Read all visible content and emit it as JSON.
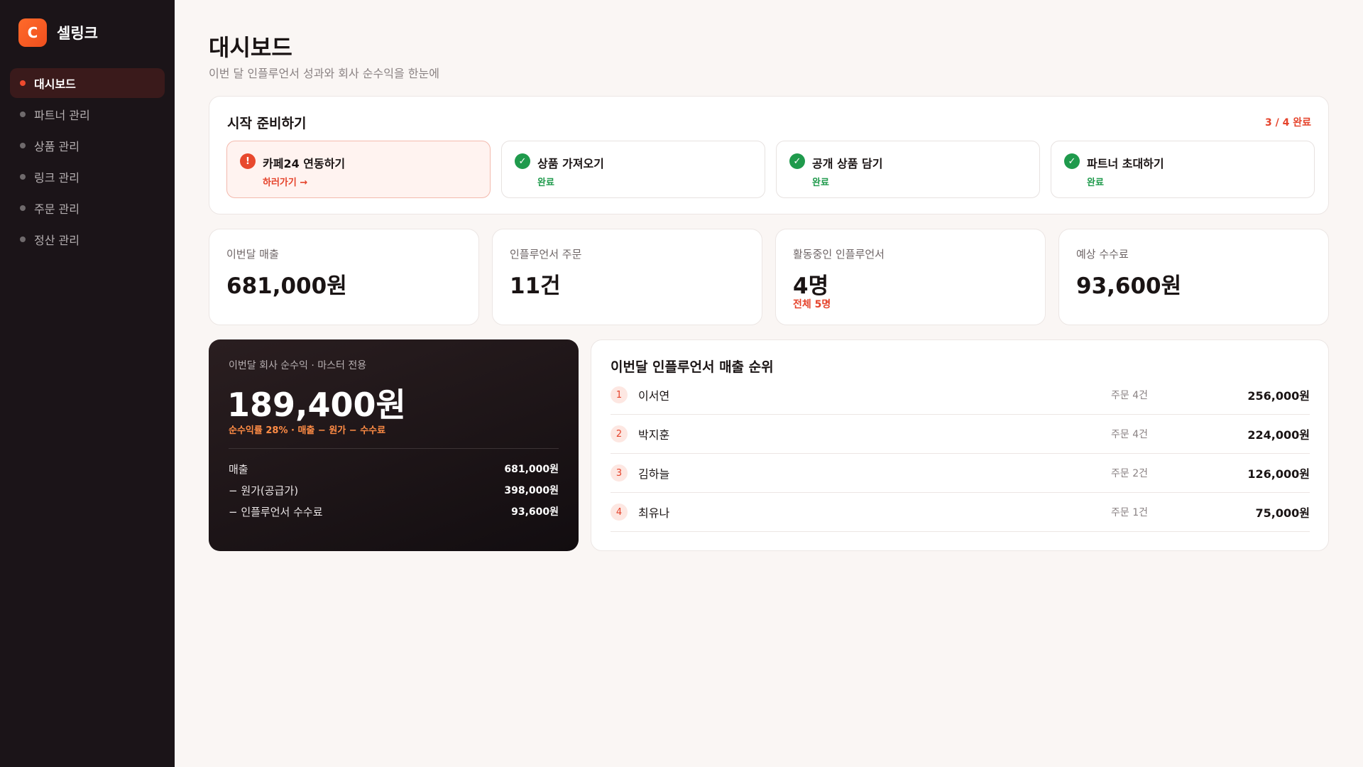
{
  "brand": {
    "logo_letter": "C",
    "name": "셀링크"
  },
  "sidebar": {
    "items": [
      {
        "label": "대시보드",
        "active": true
      },
      {
        "label": "파트너 관리"
      },
      {
        "label": "상품 관리"
      },
      {
        "label": "링크 관리"
      },
      {
        "label": "주문 관리"
      },
      {
        "label": "정산 관리"
      }
    ]
  },
  "header": {
    "title": "대시보드",
    "subtitle": "이번 달 인플루언서 성과와 회사 순수익을 한눈에"
  },
  "setup": {
    "title": "시작 준비하기",
    "progress": "3 / 4 완료",
    "steps": [
      {
        "name": "카페24 연동하기",
        "status": "하러가기 →",
        "state": "pending"
      },
      {
        "name": "상품 가져오기",
        "status": "완료",
        "state": "done"
      },
      {
        "name": "공개 상품 담기",
        "status": "완료",
        "state": "done"
      },
      {
        "name": "파트너 초대하기",
        "status": "완료",
        "state": "done"
      }
    ]
  },
  "stats": [
    {
      "label": "이번달 매출",
      "value": "681,000원"
    },
    {
      "label": "인플루언서 주문",
      "value": "11건"
    },
    {
      "label": "활동중인 인플루언서",
      "value": "4명",
      "sub": "전체 5명"
    },
    {
      "label": "예상 수수료",
      "value": "93,600원"
    }
  ],
  "profit": {
    "label": "이번달 회사 순수익 · 마스터 전용",
    "value": "189,400원",
    "formula": "순수익률 28% · 매출 − 원가 − 수수료",
    "rows": [
      {
        "label": "매출",
        "amount": "681,000원"
      },
      {
        "label": "− 원가(공급가)",
        "amount": "398,000원"
      },
      {
        "label": "− 인플루언서 수수료",
        "amount": "93,600원"
      }
    ]
  },
  "ranking": {
    "title": "이번달 인플루언서 매출 순위",
    "rows": [
      {
        "rank": "1",
        "name": "이서연",
        "orders": "주문 4건",
        "amount": "256,000원"
      },
      {
        "rank": "2",
        "name": "박지훈",
        "orders": "주문 4건",
        "amount": "224,000원"
      },
      {
        "rank": "3",
        "name": "김하늘",
        "orders": "주문 2건",
        "amount": "126,000원"
      },
      {
        "rank": "4",
        "name": "최유나",
        "orders": "주문 1건",
        "amount": "75,000원"
      }
    ]
  },
  "colors": {
    "accent": "#e5432b",
    "success": "#1f9a4c",
    "sidebar_bg": "#1b1418",
    "page_bg": "#faf6f4"
  },
  "icons": {
    "done": "check-circle-icon",
    "pending": "alert-circle-icon"
  }
}
